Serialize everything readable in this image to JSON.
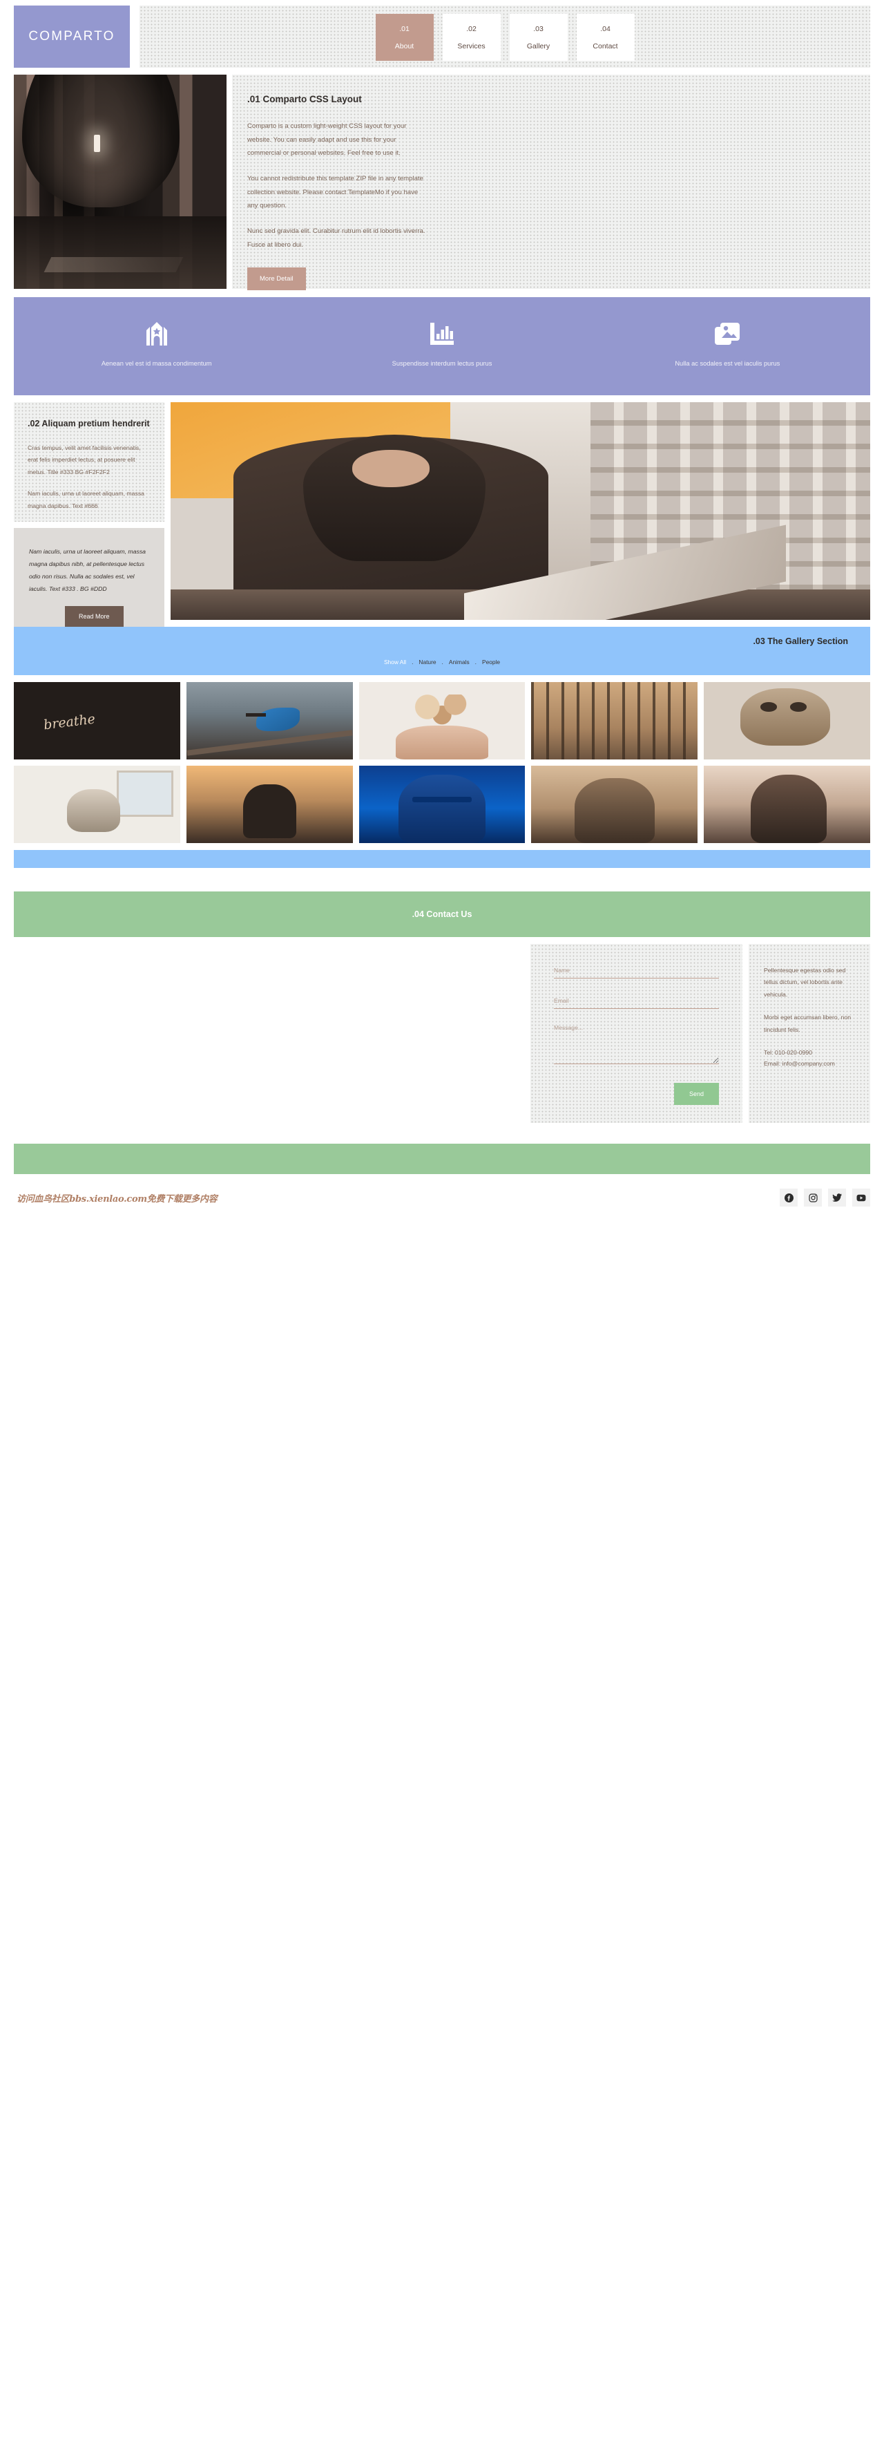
{
  "brand": {
    "name": "COMPARTO"
  },
  "nav": {
    "items": [
      {
        "num": ".01",
        "label": "About",
        "active": true
      },
      {
        "num": ".02",
        "label": "Services",
        "active": false
      },
      {
        "num": ".03",
        "label": "Gallery",
        "active": false
      },
      {
        "num": ".04",
        "label": "Contact",
        "active": false
      }
    ]
  },
  "about": {
    "title": ".01 Comparto CSS Layout",
    "p1": "Comparto is a custom light-weight CSS layout for your website. You can easily adapt and use this for your commercial or personal websites. Feel free to use it.",
    "p2": "You cannot redistribute this template ZIP file in any template collection website. Please contact TemplateMo if you have any question.",
    "p3": "Nunc sed gravida elit. Curabitur rutrum elit id lobortis viverra. Fusce at libero dui.",
    "button": "More Detail"
  },
  "services": {
    "items": [
      {
        "icon": "church-icon",
        "label": "Aenean vel est id massa condimentum"
      },
      {
        "icon": "bar-chart-icon",
        "label": "Suspendisse interdum lectus purus"
      },
      {
        "icon": "images-icon",
        "label": "Nulla ac sodales est vel iaculis purus"
      }
    ]
  },
  "section02": {
    "title": ".02 Aliquam pretium hendrerit",
    "p1": "Cras tempus, velit amet facilisis venenatis, erat felis imperdiet lectus, at posuere elit metus. Title #333 BG #F2F2F2",
    "p2": "Nam iaculis, urna ut laoreet aliquam, massa magna dapibus. Text #666",
    "quote": "Nam iaculis, urna ut laoreet aliquam, massa magna dapibus nibh, at pellentesque lectus odio non risus. Nulla ac sodales est, vel iaculis. Text #333 . BG #DDD",
    "button": "Read More"
  },
  "gallery": {
    "title": ".03 The Gallery Section",
    "filters": [
      {
        "label": "Show All",
        "active": true
      },
      {
        "label": "Nature",
        "active": false
      },
      {
        "label": "Animals",
        "active": false
      },
      {
        "label": "People",
        "active": false
      }
    ],
    "separator": ".",
    "items": [
      {
        "name": "breathe-calligraphy"
      },
      {
        "name": "kingfisher-bird"
      },
      {
        "name": "hands-holding-flowers"
      },
      {
        "name": "autumn-forest"
      },
      {
        "name": "owl-statue"
      },
      {
        "name": "cat-on-table"
      },
      {
        "name": "silhouette-sunset"
      },
      {
        "name": "blue-light-portrait"
      },
      {
        "name": "smiling-woman-headband"
      },
      {
        "name": "woman-bokeh-portrait"
      }
    ]
  },
  "contact": {
    "title": ".04 Contact Us",
    "form": {
      "name_placeholder": "Name",
      "email_placeholder": "Email",
      "message_placeholder": "Message...",
      "name_value": "",
      "email_value": "",
      "message_value": "",
      "send_label": "Send"
    },
    "info": {
      "p1": "Pellentesque egestas odio sed tellus dictum, vel lobortis ante vehicula.",
      "p2": "Morbi eget accumsan libero, non tincidunt felis.",
      "tel": "Tel: 010-020-0990",
      "email": "Email: info@company.com"
    }
  },
  "footer": {
    "watermark": "访问血鸟社区bbs.xienlao.com免费下载更多内容",
    "social": [
      {
        "name": "facebook-icon"
      },
      {
        "name": "instagram-icon"
      },
      {
        "name": "twitter-icon"
      },
      {
        "name": "youtube-icon"
      }
    ]
  },
  "colors": {
    "brand_purple": "#9498cf",
    "accent_rose": "#c29b8e",
    "gallery_blue": "#90c4fb",
    "contact_green": "#99c999",
    "quote_bg": "#DDD",
    "panel_bg": "#F2F2F2",
    "text_dark": "#333",
    "text_body": "#666"
  }
}
